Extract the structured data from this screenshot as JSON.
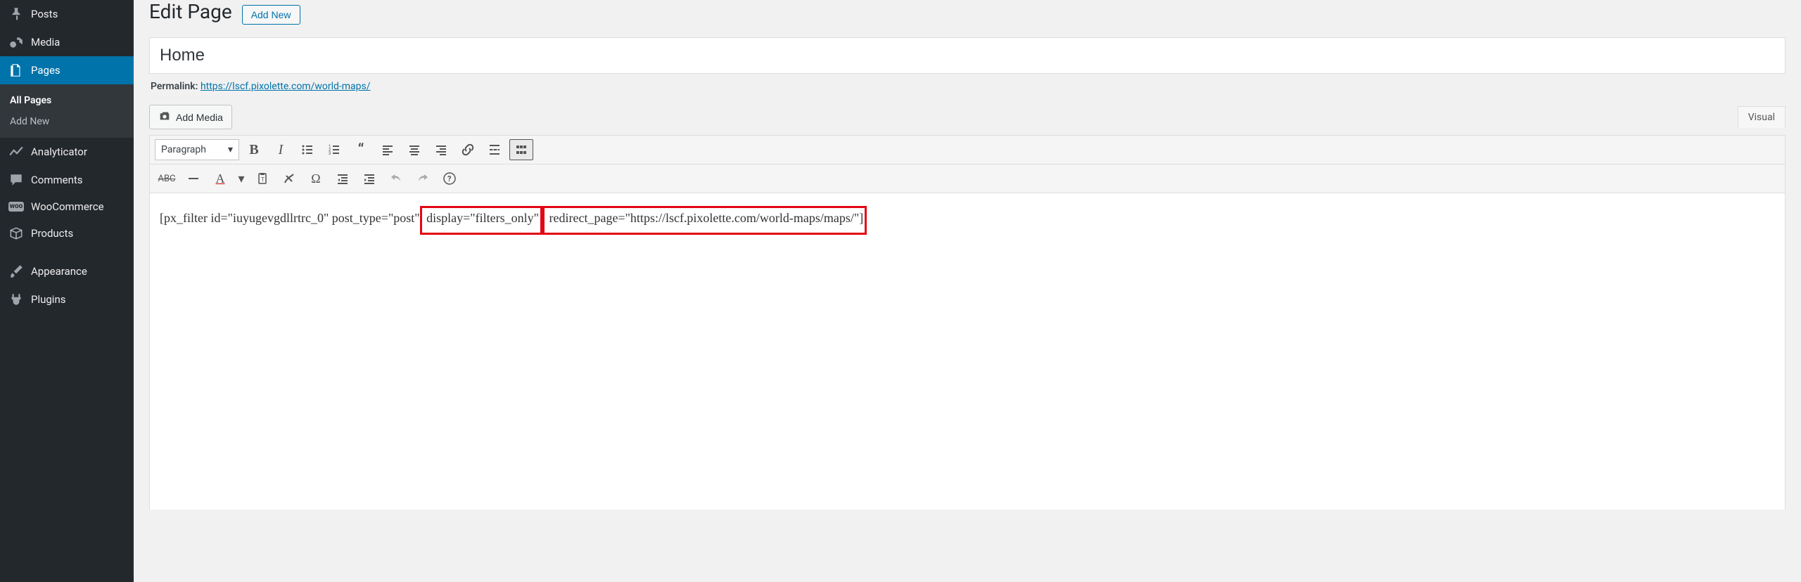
{
  "sidebar": {
    "items": [
      {
        "label": "Posts",
        "icon": "pin"
      },
      {
        "label": "Media",
        "icon": "media"
      },
      {
        "label": "Pages",
        "icon": "page",
        "current": true,
        "submenu": [
          {
            "label": "All Pages",
            "active": true
          },
          {
            "label": "Add New"
          }
        ]
      },
      {
        "label": "Analyticator",
        "icon": "chart"
      },
      {
        "label": "Comments",
        "icon": "comment"
      },
      {
        "label": "WooCommerce",
        "icon": "woo"
      },
      {
        "label": "Products",
        "icon": "box"
      },
      {
        "label": "Appearance",
        "icon": "brush",
        "sep_before": true
      },
      {
        "label": "Plugins",
        "icon": "plug"
      }
    ]
  },
  "header": {
    "title": "Edit Page",
    "add_new": "Add New"
  },
  "post": {
    "title": "Home",
    "permalink_label": "Permalink:",
    "permalink_url": "https://lscf.pixolette.com/world-maps/"
  },
  "media_button": "Add Media",
  "tabs": {
    "visual": "Visual"
  },
  "toolbar": {
    "format": "Paragraph",
    "row1": [
      "bold",
      "italic",
      "ul",
      "ol",
      "quote",
      "alignleft",
      "aligncenter",
      "alignright",
      "link",
      "more",
      "toolbar-toggle"
    ],
    "row2": [
      "strike",
      "hr",
      "textcolor",
      "color-dd",
      "paste",
      "clear",
      "charmap",
      "outdent",
      "indent",
      "undo",
      "redo",
      "help"
    ]
  },
  "content": {
    "seg1": "[px_filter id=\"iuyugevgdllrtrc_0\" post_type=\"post\"",
    "seg2": " display=\"filters_only\"",
    "seg3": " redirect_page=\"https://lscf.pixolette.com/world-maps/maps/\"]"
  }
}
